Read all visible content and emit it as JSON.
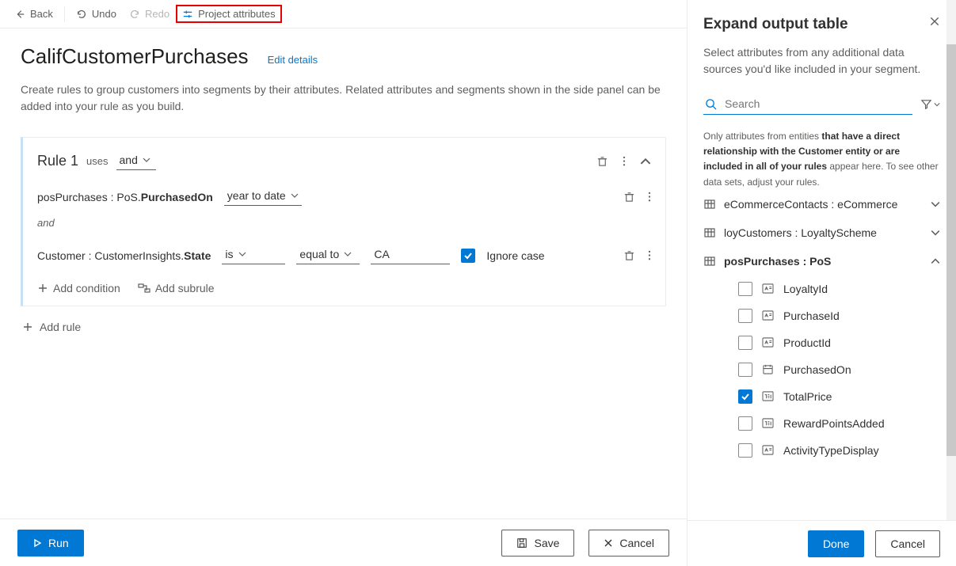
{
  "toolbar": {
    "back": "Back",
    "undo": "Undo",
    "redo": "Redo",
    "project_attributes": "Project attributes"
  },
  "page": {
    "title": "CalifCustomerPurchases",
    "edit": "Edit details",
    "description": "Create rules to group customers into segments by their attributes. Related attributes and segments shown in the side panel can be added into your rule as you build."
  },
  "rule": {
    "name": "Rule 1",
    "uses": "uses",
    "op": "and",
    "conditions": [
      {
        "attr_prefix": "posPurchases : PoS.",
        "attr_bold": "PurchasedOn",
        "operator": "year to date"
      },
      {
        "joiner": "and",
        "attr_prefix": "Customer : CustomerInsights.",
        "attr_bold": "State",
        "operator1": "is",
        "operator2": "equal to",
        "value": "CA",
        "ignore_case_checked": true,
        "ignore_case_label": "Ignore case"
      }
    ],
    "add_condition": "Add condition",
    "add_subrule": "Add subrule"
  },
  "add_rule": "Add rule",
  "footer": {
    "run": "Run",
    "save": "Save",
    "cancel": "Cancel"
  },
  "panel": {
    "title": "Expand output table",
    "subtitle": "Select attributes from any additional data sources you'd like included in your segment.",
    "search_placeholder": "Search",
    "hint_pre": "Only attributes from entities ",
    "hint_bold1": "that have a direct relationship with the Customer entity or are included in all of your rules",
    "hint_post": " appear here. To see other data sets, adjust your rules.",
    "entities": [
      {
        "label": "eCommerceContacts : eCommerce",
        "expanded": false
      },
      {
        "label": "loyCustomers : LoyaltyScheme",
        "expanded": false
      },
      {
        "label": "posPurchases : PoS",
        "expanded": true,
        "attributes": [
          {
            "label": "LoyaltyId",
            "type": "text",
            "checked": false
          },
          {
            "label": "PurchaseId",
            "type": "text",
            "checked": false
          },
          {
            "label": "ProductId",
            "type": "text",
            "checked": false
          },
          {
            "label": "PurchasedOn",
            "type": "date",
            "checked": false
          },
          {
            "label": "TotalPrice",
            "type": "number",
            "checked": true
          },
          {
            "label": "RewardPointsAdded",
            "type": "number",
            "checked": false
          },
          {
            "label": "ActivityTypeDisplay",
            "type": "text",
            "checked": false
          }
        ]
      }
    ],
    "done": "Done",
    "cancel": "Cancel"
  }
}
